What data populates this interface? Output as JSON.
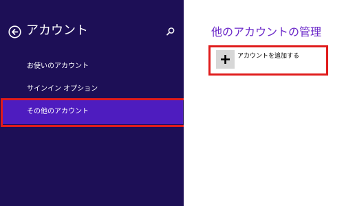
{
  "sidebar": {
    "title": "アカウント",
    "back_icon": "back-arrow-circle-icon",
    "search_icon": "search-icon",
    "items": [
      {
        "label": "お使いのアカウント",
        "selected": false
      },
      {
        "label": "サインイン オプション",
        "selected": false
      },
      {
        "label": "その他のアカウント",
        "selected": true
      }
    ]
  },
  "main": {
    "title": "他のアカウントの管理",
    "add_account": {
      "icon": "plus-icon",
      "label": "アカウントを追加する"
    }
  },
  "colors": {
    "sidebar_bg": "#1d0f56",
    "selected_item_bg": "#4e1cbf",
    "title_purple": "#6a27c8",
    "highlight_red": "#e01b1b",
    "tile_gray": "#d7d7d7"
  }
}
